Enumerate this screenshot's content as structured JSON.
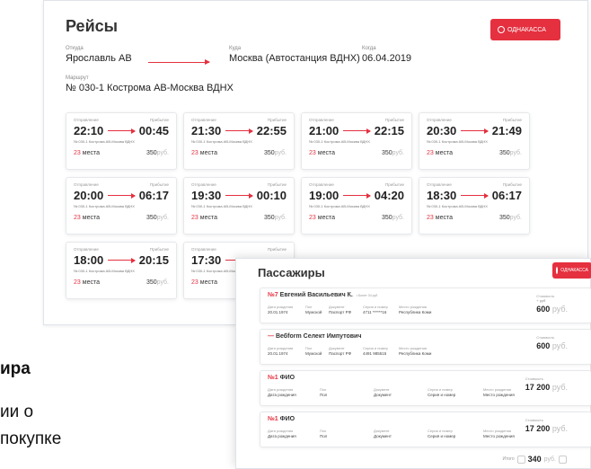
{
  "flights_panel": {
    "title": "Рейсы",
    "logo_label": "ОДНАКАССА",
    "from_label": "Откуда",
    "from_value": "Ярославль АВ",
    "to_label": "Куда",
    "to_value": "Москва (Автостанция ВДНХ)",
    "date_label": "Когда",
    "date_value": "06.04.2019",
    "route_label": "Маршрут",
    "route_value": "№ 030-1 Кострома АВ-Москва ВДНХ",
    "depart_label": "Отправление",
    "arrive_label": "Прибытие",
    "currency": "руб.",
    "cards": [
      {
        "depart": "22:10",
        "arrive": "00:45",
        "route": "№ 030-1 Кострома АВ-Москва ВДНХ",
        "seats": "23",
        "seats_word": "места",
        "price": "350"
      },
      {
        "depart": "21:30",
        "arrive": "22:55",
        "route": "№ 030-1 Кострома АВ-Москва ВДНХ",
        "seats": "23",
        "seats_word": "места",
        "price": "350"
      },
      {
        "depart": "21:00",
        "arrive": "22:15",
        "route": "№ 030-1 Кострома АВ-Москва ВДНХ",
        "seats": "23",
        "seats_word": "места",
        "price": "350"
      },
      {
        "depart": "20:30",
        "arrive": "21:49",
        "route": "№ 030-1 Кострома АВ-Москва ВДНХ",
        "seats": "23",
        "seats_word": "места",
        "price": "350"
      },
      {
        "depart": "20:00",
        "arrive": "06:17",
        "route": "№ 030-1 Кострома АВ-Москва ВДНХ",
        "seats": "23",
        "seats_word": "места",
        "price": "350"
      },
      {
        "depart": "19:30",
        "arrive": "00:10",
        "route": "№ 030-1 Кострома АВ-Москва ВДНХ",
        "seats": "23",
        "seats_word": "места",
        "price": "350"
      },
      {
        "depart": "19:00",
        "arrive": "04:20",
        "route": "№ 030-1 Кострома АВ-Москва ВДНХ",
        "seats": "23",
        "seats_word": "места",
        "price": "350"
      },
      {
        "depart": "18:30",
        "arrive": "06:17",
        "route": "№ 030-1 Кострома АВ-Москва ВДНХ",
        "seats": "23",
        "seats_word": "места",
        "price": "350"
      },
      {
        "depart": "18:00",
        "arrive": "20:15",
        "route": "№ 030-1 Кострома АВ-Москва ВДНХ",
        "seats": "23",
        "seats_word": "места",
        "price": "350"
      },
      {
        "depart": "17:30",
        "arrive": "",
        "route": "№ 030-1 Кострома АВ-Москва ВДНХ",
        "seats": "23",
        "seats_word": "места",
        "price": "350"
      }
    ]
  },
  "left_fragments": {
    "line1": "ира",
    "line2": "ии о",
    "line3": "покупке"
  },
  "passengers_panel": {
    "title": "Пассажиры",
    "logo_label": "ОДНАКАССА",
    "cost_label": "Стоимость",
    "birth_label": "Дата рождения",
    "sex_label": "Пол",
    "doc_label": "Документ",
    "series_label": "Серия и номер",
    "place_label": "Место рождения",
    "currency": "руб.",
    "rows": [
      {
        "no": "№7",
        "name": "Евгений Васильевич К.",
        "tag": "• Билет 34 руб",
        "birth": "20.01.1974",
        "sex": "Мужской",
        "doc": "Паспорт РФ",
        "series": "4711 ******16",
        "place": "Республика Коми",
        "cost_sub": "+ руб",
        "cost": "600"
      },
      {
        "no": "—",
        "name": "Вебform Селект Импутович",
        "tag": "",
        "birth": "20.01.1974",
        "sex": "Мужской",
        "doc": "Паспорт РФ",
        "series": "4491 985515",
        "place": "Республика Коми",
        "cost_sub": "",
        "cost": "600"
      },
      {
        "no": "№1",
        "name": "ФИО",
        "tag": "",
        "birth": "Дата рождения",
        "sex": "Пол",
        "doc": "Документ",
        "series": "Серия и номер",
        "place": "Место рождения",
        "cost_sub": "",
        "cost": "17 200"
      },
      {
        "no": "№1",
        "name": "ФИО",
        "tag": "",
        "birth": "Дата рождения",
        "sex": "Пол",
        "doc": "Документ",
        "series": "Серия и номер",
        "place": "Место рождения",
        "cost_sub": "",
        "cost": "17 200"
      }
    ],
    "total_label": "Итого",
    "total_value": "340"
  }
}
